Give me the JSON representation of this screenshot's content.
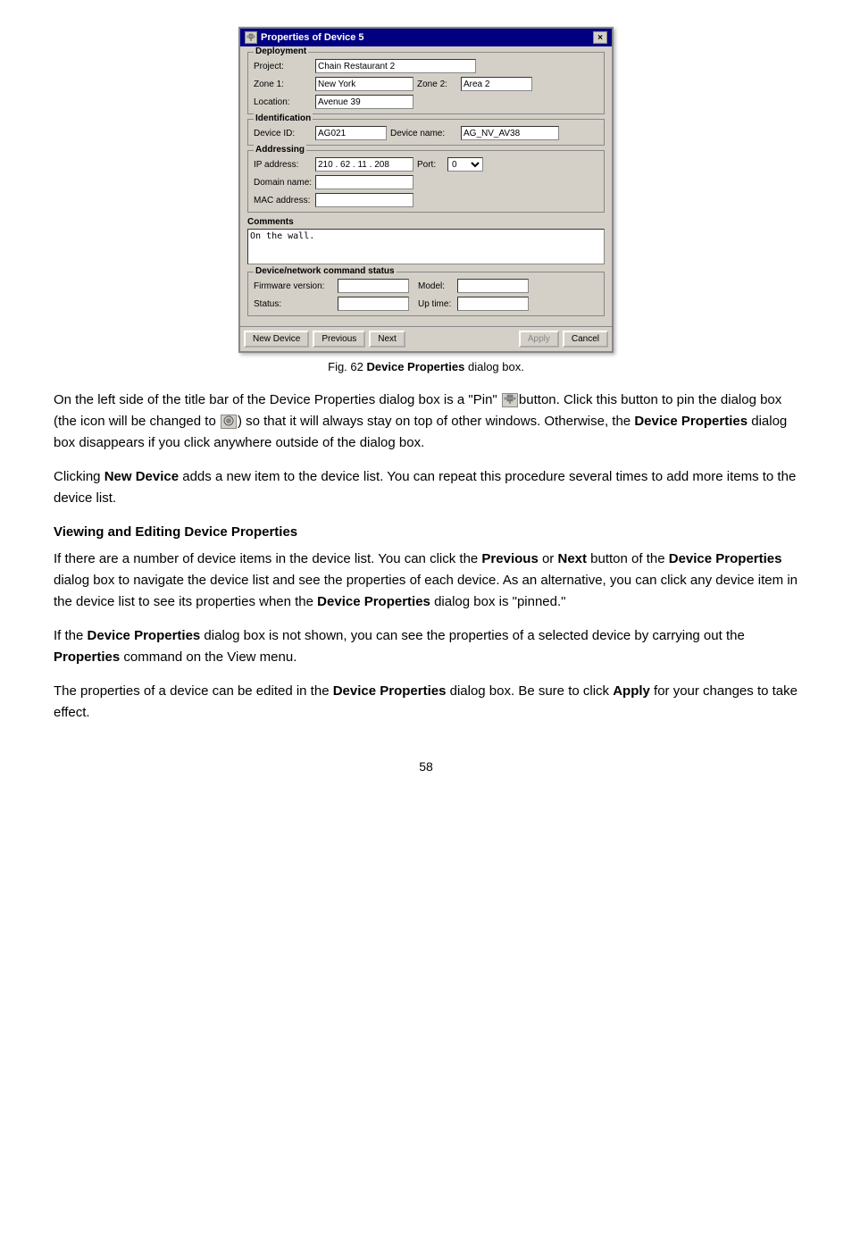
{
  "dialog": {
    "title": "Properties of Device 5",
    "close_btn": "×",
    "sections": {
      "deployment": {
        "label": "Deployment",
        "project_label": "Project:",
        "project_value": "Chain Restaurant 2",
        "zone1_label": "Zone 1:",
        "zone1_value": "New York",
        "zone2_label": "Zone 2:",
        "zone2_value": "Area 2",
        "location_label": "Location:",
        "location_value": "Avenue 39"
      },
      "identification": {
        "label": "Identification",
        "device_id_label": "Device ID:",
        "device_id_value": "AG021",
        "device_name_label": "Device name:",
        "device_name_value": "AG_NV_AV38"
      },
      "addressing": {
        "label": "Addressing",
        "ip_label": "IP address:",
        "ip_value": "210 . 62 . 11 . 208",
        "port_label": "Port:",
        "port_value": "0",
        "domain_label": "Domain name:",
        "domain_value": "",
        "mac_label": "MAC address:",
        "mac_value": ""
      },
      "comments": {
        "label": "Comments",
        "value": "On the wall."
      },
      "device_network": {
        "label": "Device/network command status",
        "firmware_label": "Firmware version:",
        "firmware_value": "",
        "model_label": "Model:",
        "model_value": "",
        "status_label": "Status:",
        "status_value": "",
        "uptime_label": "Up time:",
        "uptime_value": ""
      }
    },
    "buttons": {
      "new_device": "New Device",
      "previous": "Previous",
      "next": "Next",
      "apply": "Apply",
      "cancel": "Cancel"
    }
  },
  "figure": {
    "caption": "Fig. 62",
    "caption_bold": "Device Properties",
    "caption_rest": "dialog box."
  },
  "body_text": {
    "para1_start": "On the left side of the title bar of the Device Properties dialog box is a \"Pin\" ",
    "para1_pin_icon_label": "[pin]",
    "para1_mid": "button. Click this button to pin the dialog box (the icon will be changed to ",
    "para1_pinned_icon_label": "[pinned]",
    "para1_end": ") so that it will always stay on top of other windows. Otherwise, the ",
    "para1_bold1": "Device Properties",
    "para1_end2": " dialog box disappears if you click anywhere outside of the dialog box.",
    "para2_start": "Clicking ",
    "para2_bold": "New Device",
    "para2_end": " adds a new item to the device list. You can repeat this procedure several times to add more items to the device list.",
    "heading2": "Viewing and Editing Device Properties",
    "para3_start": "If there are a number of device items in the device list. You can click the ",
    "para3_bold1": "Previous",
    "para3_mid1": " or ",
    "para3_bold2": "Next",
    "para3_mid2": " button of the ",
    "para3_bold3": "Device Properties",
    "para3_mid3": " dialog box to navigate the device list and see the properties of each device. As an alternative, you can click any device item in the device list to see its properties when the ",
    "para3_bold4": "Device Properties",
    "para3_end": " dialog box is \"pinned.\"",
    "para4_start": "If the ",
    "para4_bold1": "Device Properties",
    "para4_mid": " dialog box is not shown, you can see the properties of a selected device by carrying out the ",
    "para4_bold2": "Properties",
    "para4_end": " command on the View menu.",
    "para5_start": "The properties of a device can be edited in the ",
    "para5_bold": "Device Properties",
    "para5_end": " dialog box. Be sure to click ",
    "para5_bold2": "Apply",
    "para5_end2": " for your changes to take effect."
  },
  "page_number": "58"
}
